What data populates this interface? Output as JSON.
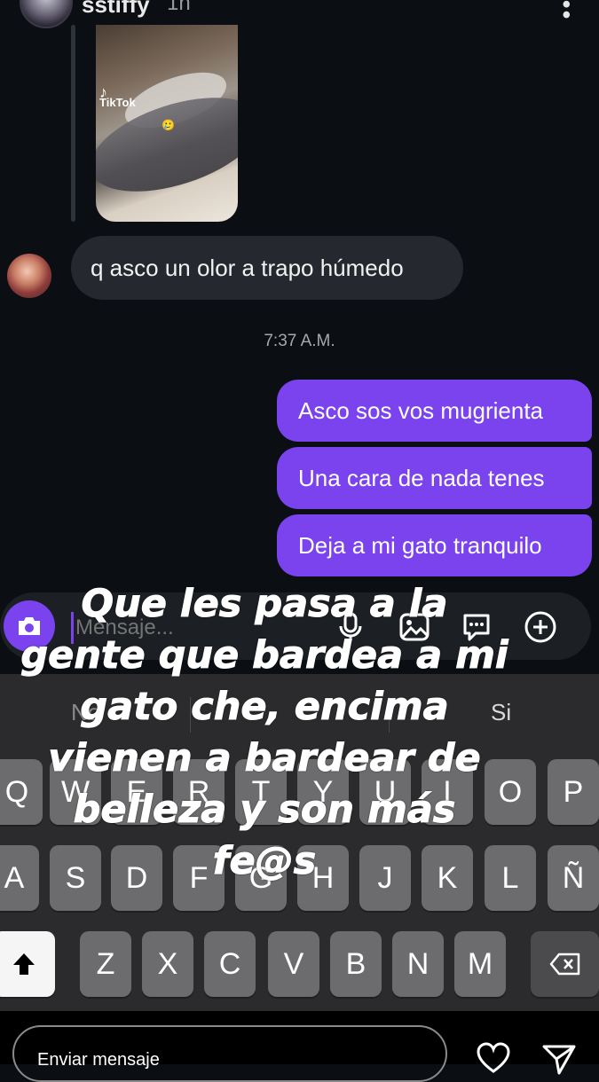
{
  "header": {
    "username": "sstiffy",
    "time_ago": "1h",
    "menu_icon": "more-vertical-icon"
  },
  "shared_video": {
    "platform_label": "TikTok",
    "emoji": "🥲"
  },
  "messages": [
    {
      "direction": "in",
      "text": "q asco un olor a trapo húmedo"
    },
    {
      "direction": "out",
      "text": "Asco sos vos mugrienta"
    },
    {
      "direction": "out",
      "text": "Una cara de nada tenes"
    },
    {
      "direction": "out",
      "text": "Deja a mi gato tranquilo"
    }
  ],
  "timestamp": "7:37 A.M.",
  "composer": {
    "placeholder": "Mensaje...",
    "icons": [
      "camera-icon",
      "microphone-icon",
      "gallery-icon",
      "sticker-icon",
      "plus-icon"
    ]
  },
  "keyboard": {
    "suggestions": [
      "No",
      "Si"
    ],
    "row1": [
      "Q",
      "W",
      "E",
      "R",
      "T",
      "Y",
      "U",
      "I",
      "O",
      "P"
    ],
    "row2": [
      "A",
      "S",
      "D",
      "F",
      "G",
      "H",
      "J",
      "K",
      "L",
      "Ñ"
    ],
    "row3": [
      "Z",
      "X",
      "C",
      "V",
      "B",
      "N",
      "M"
    ]
  },
  "caption": "Que les pasa a la gente que bardea a mi gato che, encima vienen a bardear de belleza y son más fe@s",
  "story_footer": {
    "send_placeholder": "Enviar mensaje"
  },
  "colors": {
    "accent": "#7a43ee",
    "background": "#0b0f13",
    "incoming_bubble": "#25282e",
    "keyboard": "#2b2b2d"
  }
}
